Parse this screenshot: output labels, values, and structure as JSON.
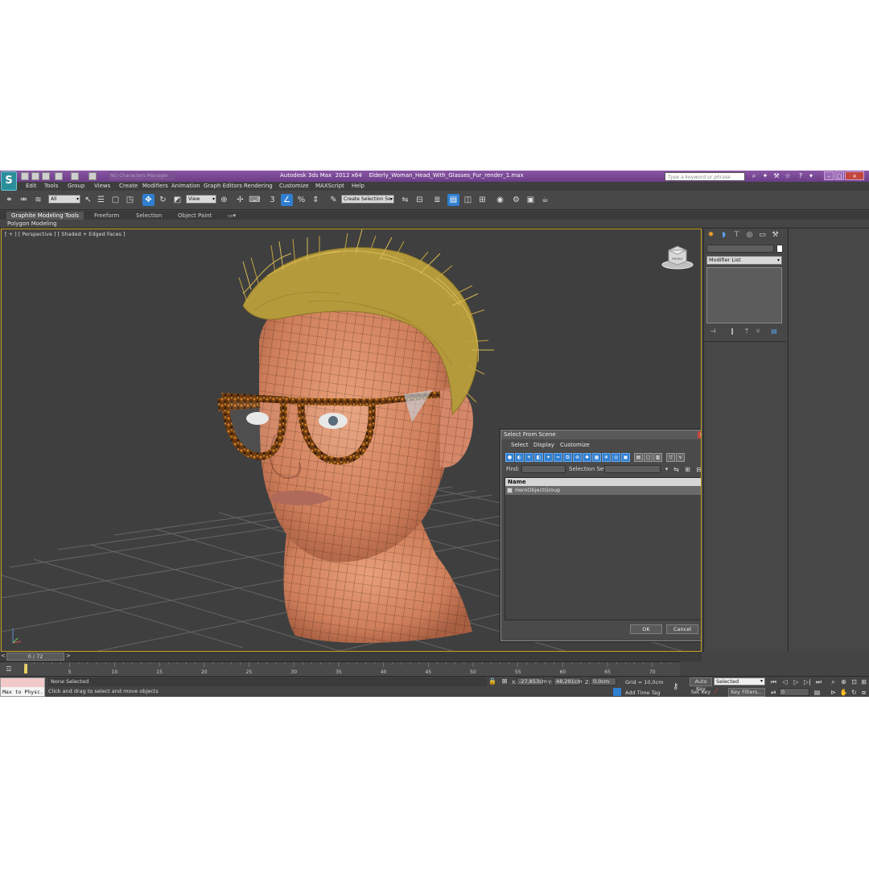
{
  "titlebar": {
    "logo": "S",
    "project_placeholder": "NO Characters Manager",
    "app_title": "Autodesk 3ds Max  2012 x64",
    "file_name": "Elderly_Woman_Head_With_Glasses_Fur_render_1.max",
    "search_placeholder": "Type a keyword or phrase",
    "window_buttons": {
      "minimize": "–",
      "maximize": "□",
      "close": "×"
    }
  },
  "menu": [
    "Edit",
    "Tools",
    "Group",
    "Views",
    "Create",
    "Modifiers",
    "Animation",
    "Graph Editors",
    "Rendering",
    "Customize",
    "MAXScript",
    "Help"
  ],
  "toolbar": {
    "filter_value": "All",
    "ref_coord_value": "View",
    "selection_set_value": "Create Selection Se"
  },
  "ribbon": {
    "tabs": [
      "Graphite Modeling Tools",
      "Freeform",
      "Selection",
      "Object Paint"
    ],
    "subpanel": "Polygon Modeling"
  },
  "viewport": {
    "label": "[ + ] [ Perspective ] [ Shaded + Edged Faces ]",
    "view_cube_label": "FRONT"
  },
  "dialog": {
    "title": "Select From Scene",
    "close": "×",
    "menu": [
      "Select",
      "Display",
      "Customize"
    ],
    "find_label": "Find:",
    "selection_set_label": "Selection Set:",
    "column_header": "Name",
    "rows": [
      "HeroObjectGroup"
    ],
    "ok_label": "OK",
    "cancel_label": "Cancel"
  },
  "command_panel": {
    "modifier_list": "Modifier List"
  },
  "timeline": {
    "frame_readout": "0 / 72",
    "ticks": [
      "5",
      "10",
      "15",
      "20",
      "25",
      "30",
      "35",
      "40",
      "45",
      "50",
      "55",
      "60",
      "65",
      "70"
    ]
  },
  "status": {
    "maxscript_label": "Max to Physc.",
    "selection_text": "None Selected",
    "prompt_text": "Click and drag to select and move objects",
    "x_label": "X:",
    "x_value": "-27,853cm",
    "y_label": "Y:",
    "y_value": "48,291cm",
    "z_label": "Z:",
    "z_value": "0,0cm",
    "grid_text": "Grid = 10,0cm",
    "add_time_tag": "Add Time Tag",
    "auto_key": "Auto Key",
    "set_key": "Set Key",
    "selected_value": "Selected",
    "key_filters": "Key Filters...",
    "frame_value": "0"
  },
  "colors": {
    "accent_blue": "#2f7fd1",
    "title_purple": "#7a4a96",
    "viewport_border": "#c8a020",
    "hair": "#c2a440",
    "skin": "#d98a66"
  }
}
